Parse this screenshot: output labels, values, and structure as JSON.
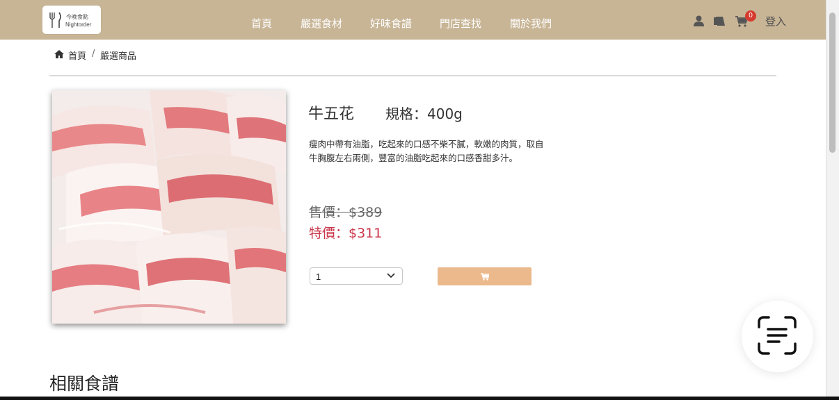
{
  "brand": {
    "logo_text_cn": "今晚食點",
    "logo_text_en": "Nightorder"
  },
  "nav": {
    "links": [
      "首頁",
      "嚴選食材",
      "好味食譜",
      "門店查找",
      "關於我們"
    ],
    "cart_count": "0",
    "login_label": "登入",
    "icons": [
      "user-icon",
      "book-icon",
      "cart-icon"
    ]
  },
  "breadcrumb": {
    "home": "首頁",
    "separator": "/",
    "current": "嚴選商品"
  },
  "product": {
    "name": "牛五花",
    "spec": "規格：400g",
    "description": "瘦肉中帶有油脂，吃起來的口感不柴不膩，軟嫩的肉質，取自牛胸腹左右兩側，豐富的油脂吃起來的口感香甜多汁。",
    "price_original": "售價：$389",
    "price_special": "特價：$311",
    "quantity_selected": "1"
  },
  "related": {
    "title": "相關食譜"
  },
  "colors": {
    "navbar": "#c8b596",
    "special_price": "#c9354a",
    "add_to_cart": "#ebb98c",
    "badge": "#d63b2f"
  }
}
